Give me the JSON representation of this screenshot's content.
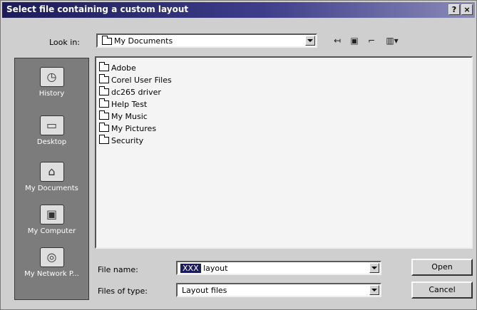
{
  "dialog": {
    "title": "Select file containing a custom layout",
    "help_button": "?",
    "close_button": "×"
  },
  "look_in": {
    "label": "Look in:",
    "value": "My Documents"
  },
  "toolbar": {
    "back_icon": "↤",
    "up_folder_icon": "▣",
    "new_folder_icon": "⌐",
    "views_icon": "▥▾"
  },
  "places": [
    {
      "label": "History",
      "icon": "history-icon"
    },
    {
      "label": "Desktop",
      "icon": "desktop-icon"
    },
    {
      "label": "My Documents",
      "icon": "my-documents-icon"
    },
    {
      "label": "My Computer",
      "icon": "my-computer-icon"
    },
    {
      "label": "My Network P...",
      "icon": "my-network-places-icon"
    }
  ],
  "files": [
    "Adobe",
    "Corel User Files",
    "dc265 driver",
    "Help Test",
    "My Music",
    "My Pictures",
    "Security"
  ],
  "file_name": {
    "label": "File name:",
    "selected": "XXX",
    "rest": " layout"
  },
  "file_type": {
    "label": "Files of type:",
    "value": "Layout files"
  },
  "buttons": {
    "open": "Open",
    "cancel": "Cancel"
  }
}
